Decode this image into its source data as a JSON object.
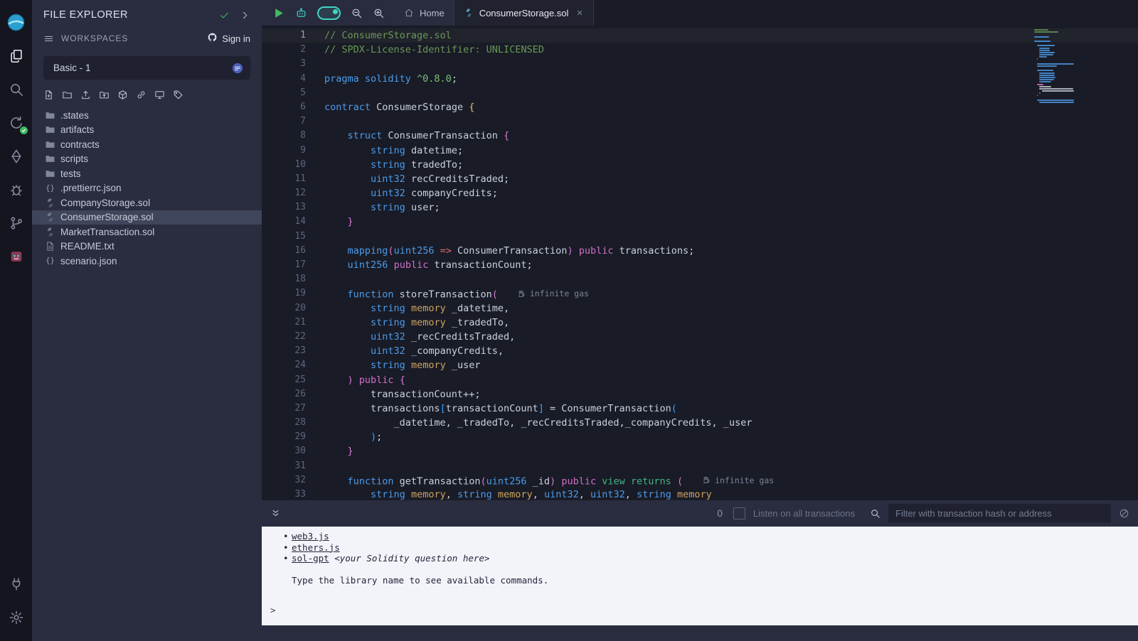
{
  "colors": {
    "activityBar": "#14151e",
    "sidePanel": "#2a2c3f",
    "editorBg": "#191b26",
    "tabbarBg": "#292b3e",
    "activeTabBg": "#20222f",
    "selectedFileBg": "#3f455b",
    "inputBg": "#1f2130",
    "terminalBg": "#f3f4fa",
    "terminalText": "#23263a",
    "accentGreen": "#3fbb62",
    "accentTeal": "#3ed6c2",
    "gutter": "#5e6580",
    "tok-com": "#6a9955",
    "tok-kw": "#4d9ceb",
    "tok-typ": "#4d9ceb",
    "tok-mod": "#d06fc9",
    "tok-grn": "#45b586",
    "tok-ver": "#7bc275",
    "tok-mem": "#cea55f",
    "tok-pln": "#ccd1e0",
    "tok-b1": "#e3c16f",
    "tok-b2": "#d678d4",
    "tok-b3": "#3aa0ff",
    "tok-op": "#e06c75"
  },
  "activity_bar": {
    "top": [
      {
        "name": "home",
        "icon": "remix-logo"
      },
      {
        "name": "file-explorer",
        "icon": "files",
        "active": true
      },
      {
        "name": "search",
        "icon": "search"
      },
      {
        "name": "solidity-compiler",
        "icon": "compiler",
        "badge": true
      },
      {
        "name": "deploy-and-run",
        "icon": "deploy"
      },
      {
        "name": "debugger",
        "icon": "bug"
      },
      {
        "name": "source-control",
        "icon": "git"
      },
      {
        "name": "plugin",
        "icon": "plugin"
      }
    ],
    "bottom": [
      {
        "name": "plugin-manager",
        "icon": "plug"
      },
      {
        "name": "settings",
        "icon": "gear"
      }
    ]
  },
  "side_panel": {
    "title": "FILE EXPLORER",
    "workspaces_label": "WORKSPACES",
    "sign_in": "Sign in",
    "workspace_name": "Basic - 1",
    "toolbar": [
      {
        "name": "new-file",
        "icon": "new-file"
      },
      {
        "name": "new-folder",
        "icon": "new-folder"
      },
      {
        "name": "upload-file",
        "icon": "upload-file"
      },
      {
        "name": "upload-folder",
        "icon": "upload-folder"
      },
      {
        "name": "publish-to-ipfs",
        "icon": "box"
      },
      {
        "name": "copy-link",
        "icon": "link"
      },
      {
        "name": "connect-localhost",
        "icon": "screen"
      },
      {
        "name": "tag",
        "icon": "tag"
      }
    ],
    "files": [
      {
        "name": ".states",
        "icon": "folder"
      },
      {
        "name": "artifacts",
        "icon": "folder"
      },
      {
        "name": "contracts",
        "icon": "folder"
      },
      {
        "name": "scripts",
        "icon": "folder"
      },
      {
        "name": "tests",
        "icon": "folder"
      },
      {
        "name": ".prettierrc.json",
        "icon": "json"
      },
      {
        "name": "CompanyStorage.sol",
        "icon": "sol"
      },
      {
        "name": "ConsumerStorage.sol",
        "icon": "sol",
        "selected": true
      },
      {
        "name": "MarketTransaction.sol",
        "icon": "sol"
      },
      {
        "name": "README.txt",
        "icon": "txt"
      },
      {
        "name": "scenario.json",
        "icon": "json"
      }
    ]
  },
  "editor_toolbar": [
    {
      "name": "run-script",
      "icon": "play"
    },
    {
      "name": "remix-ai",
      "icon": "ai"
    },
    {
      "name": "copilot-toggle",
      "icon": "toggle",
      "state": "on"
    },
    {
      "name": "zoom-out",
      "icon": "zoom-out"
    },
    {
      "name": "zoom-in",
      "icon": "zoom-in"
    }
  ],
  "editor": {
    "current_line": 1,
    "tabs": [
      {
        "label": "Home",
        "icon": "home"
      },
      {
        "label": "ConsumerStorage.sol",
        "icon": "sol",
        "active": true,
        "closable": true
      }
    ],
    "lines": [
      {
        "tokens": [
          [
            "// ConsumerStorage.sol",
            "com"
          ]
        ]
      },
      {
        "tokens": [
          [
            "// SPDX-License-Identifier: UNLICENSED",
            "com"
          ]
        ]
      },
      {
        "tokens": []
      },
      {
        "tokens": [
          [
            "pragma solidity ",
            "kw"
          ],
          [
            "^0.8.0",
            "ver"
          ],
          [
            ";",
            "pln"
          ]
        ]
      },
      {
        "tokens": []
      },
      {
        "tokens": [
          [
            "contract",
            "kw"
          ],
          [
            " ConsumerStorage ",
            "pln"
          ],
          [
            "{",
            "b1"
          ]
        ]
      },
      {
        "tokens": []
      },
      {
        "tokens": [
          [
            "    ",
            "pln"
          ],
          [
            "struct",
            "kw"
          ],
          [
            " ConsumerTransaction ",
            "pln"
          ],
          [
            "{",
            "b2"
          ]
        ]
      },
      {
        "tokens": [
          [
            "        ",
            "pln"
          ],
          [
            "string",
            "typ"
          ],
          [
            " datetime;",
            "pln"
          ]
        ]
      },
      {
        "tokens": [
          [
            "        ",
            "pln"
          ],
          [
            "string",
            "typ"
          ],
          [
            " tradedTo;",
            "pln"
          ]
        ]
      },
      {
        "tokens": [
          [
            "        ",
            "pln"
          ],
          [
            "uint32",
            "typ"
          ],
          [
            " recCreditsTraded;",
            "pln"
          ]
        ]
      },
      {
        "tokens": [
          [
            "        ",
            "pln"
          ],
          [
            "uint32",
            "typ"
          ],
          [
            " companyCredits;",
            "pln"
          ]
        ]
      },
      {
        "tokens": [
          [
            "        ",
            "pln"
          ],
          [
            "string",
            "typ"
          ],
          [
            " user;",
            "pln"
          ]
        ]
      },
      {
        "tokens": [
          [
            "    ",
            "pln"
          ],
          [
            "}",
            "b2"
          ]
        ]
      },
      {
        "tokens": []
      },
      {
        "tokens": [
          [
            "    ",
            "pln"
          ],
          [
            "mapping",
            "kw"
          ],
          [
            "(",
            "b2"
          ],
          [
            "uint256",
            "typ"
          ],
          [
            " ",
            "pln"
          ],
          [
            "=>",
            "op"
          ],
          [
            " ConsumerTransaction",
            "pln"
          ],
          [
            ")",
            "b2"
          ],
          [
            " ",
            "pln"
          ],
          [
            "public",
            "mod"
          ],
          [
            " transactions;",
            "pln"
          ]
        ]
      },
      {
        "tokens": [
          [
            "    ",
            "pln"
          ],
          [
            "uint256",
            "typ"
          ],
          [
            " ",
            "pln"
          ],
          [
            "public",
            "mod"
          ],
          [
            " transactionCount;",
            "pln"
          ]
        ]
      },
      {
        "tokens": []
      },
      {
        "tokens": [
          [
            "    ",
            "pln"
          ],
          [
            "function",
            "kw"
          ],
          [
            " storeTransaction",
            "pln"
          ],
          [
            "(",
            "b2"
          ]
        ],
        "gas": "infinite gas"
      },
      {
        "tokens": [
          [
            "        ",
            "pln"
          ],
          [
            "string",
            "typ"
          ],
          [
            " ",
            "pln"
          ],
          [
            "memory",
            "mem"
          ],
          [
            " _datetime,",
            "pln"
          ]
        ]
      },
      {
        "tokens": [
          [
            "        ",
            "pln"
          ],
          [
            "string",
            "typ"
          ],
          [
            " ",
            "pln"
          ],
          [
            "memory",
            "mem"
          ],
          [
            " _tradedTo,",
            "pln"
          ]
        ]
      },
      {
        "tokens": [
          [
            "        ",
            "pln"
          ],
          [
            "uint32",
            "typ"
          ],
          [
            " _recCreditsTraded,",
            "pln"
          ]
        ]
      },
      {
        "tokens": [
          [
            "        ",
            "pln"
          ],
          [
            "uint32",
            "typ"
          ],
          [
            " _companyCredits,",
            "pln"
          ]
        ]
      },
      {
        "tokens": [
          [
            "        ",
            "pln"
          ],
          [
            "string",
            "typ"
          ],
          [
            " ",
            "pln"
          ],
          [
            "memory",
            "mem"
          ],
          [
            " _user",
            "pln"
          ]
        ]
      },
      {
        "tokens": [
          [
            "    ",
            "pln"
          ],
          [
            ")",
            "b2"
          ],
          [
            " ",
            "pln"
          ],
          [
            "public",
            "mod"
          ],
          [
            " ",
            "pln"
          ],
          [
            "{",
            "b2"
          ]
        ]
      },
      {
        "tokens": [
          [
            "        transactionCount++;",
            "pln"
          ]
        ]
      },
      {
        "tokens": [
          [
            "        transactions",
            "pln"
          ],
          [
            "[",
            "b3"
          ],
          [
            "transactionCount",
            "pln"
          ],
          [
            "]",
            "b3"
          ],
          [
            " = ConsumerTransaction",
            "pln"
          ],
          [
            "(",
            "b3"
          ]
        ]
      },
      {
        "tokens": [
          [
            "            _datetime, _tradedTo, _recCreditsTraded,_companyCredits, _user",
            "pln"
          ]
        ]
      },
      {
        "tokens": [
          [
            "        ",
            "pln"
          ],
          [
            ")",
            "b3"
          ],
          [
            ";",
            "pln"
          ]
        ]
      },
      {
        "tokens": [
          [
            "    ",
            "pln"
          ],
          [
            "}",
            "b2"
          ]
        ]
      },
      {
        "tokens": []
      },
      {
        "tokens": [
          [
            "    ",
            "pln"
          ],
          [
            "function",
            "kw"
          ],
          [
            " getTransaction",
            "pln"
          ],
          [
            "(",
            "b2"
          ],
          [
            "uint256",
            "typ"
          ],
          [
            " _id",
            "pln"
          ],
          [
            ")",
            "b2"
          ],
          [
            " ",
            "pln"
          ],
          [
            "public",
            "mod"
          ],
          [
            " ",
            "pln"
          ],
          [
            "view",
            "grn"
          ],
          [
            " ",
            "pln"
          ],
          [
            "returns",
            "grn"
          ],
          [
            " ",
            "pln"
          ],
          [
            "(",
            "b2"
          ]
        ],
        "gas": "infinite gas"
      },
      {
        "tokens": [
          [
            "        ",
            "pln"
          ],
          [
            "string",
            "typ"
          ],
          [
            " ",
            "pln"
          ],
          [
            "memory",
            "mem"
          ],
          [
            ", ",
            "pln"
          ],
          [
            "string",
            "typ"
          ],
          [
            " ",
            "pln"
          ],
          [
            "memory",
            "mem"
          ],
          [
            ", ",
            "pln"
          ],
          [
            "uint32",
            "typ"
          ],
          [
            ", ",
            "pln"
          ],
          [
            "uint32",
            "typ"
          ],
          [
            ", ",
            "pln"
          ],
          [
            "string",
            "typ"
          ],
          [
            " ",
            "pln"
          ],
          [
            "memory",
            "mem"
          ]
        ]
      }
    ]
  },
  "terminal": {
    "count": "0",
    "listen_label": "Listen on all transactions",
    "filter_placeholder": "Filter with transaction hash or address",
    "prompt": ">",
    "lines": [
      {
        "bullet": true,
        "link": "web3.js"
      },
      {
        "bullet": true,
        "link": "ethers.js"
      },
      {
        "bullet": true,
        "link": "sol-gpt",
        "italic": " <your Solidity question here>"
      },
      {
        "kind": "message",
        "text": "Type the library name to see available commands."
      }
    ]
  },
  "icons": {
    "panel_header": [
      "check-icon",
      "chevron-right-icon"
    ],
    "workspaces_row": [
      "hamburger-icon",
      "github-icon",
      "workspace-badge-icon"
    ],
    "terminal_bar": [
      "chevrons-down-icon",
      "search-icon",
      "ban-icon"
    ],
    "gas_hint": "gas-pump-icon"
  }
}
